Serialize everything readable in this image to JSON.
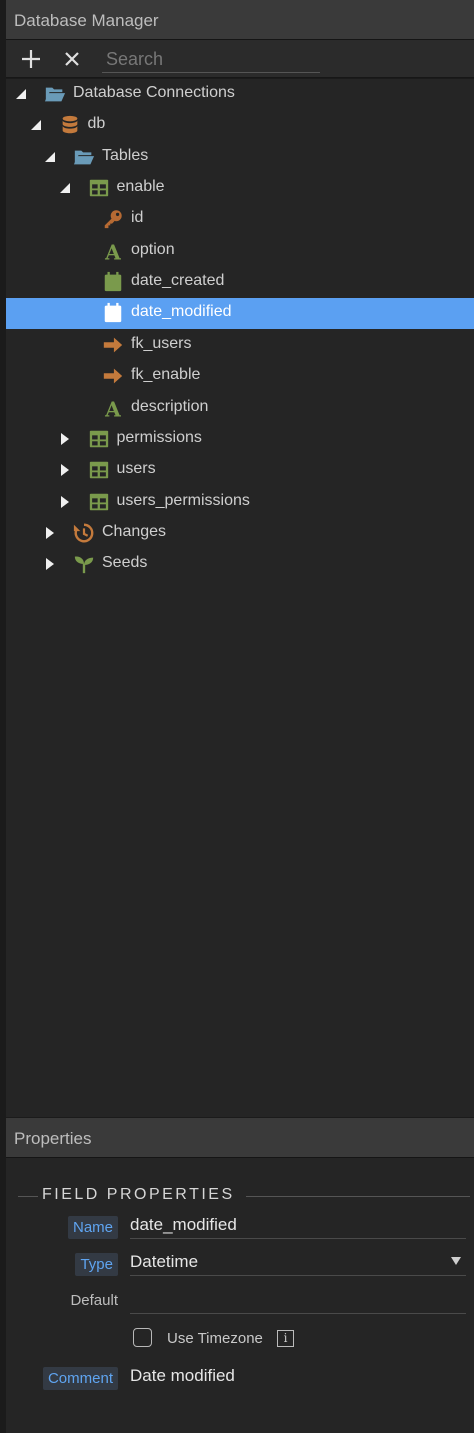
{
  "database_manager": {
    "title": "Database Manager",
    "toolbar": {
      "add_icon": "plus-icon",
      "remove_icon": "close-icon",
      "search_placeholder": "Search"
    },
    "tree": [
      {
        "label": "Database Connections",
        "icon": "folder-open-icon",
        "expanded": true
      },
      {
        "label": "db",
        "icon": "database-icon",
        "expanded": true
      },
      {
        "label": "Tables",
        "icon": "folder-open-icon",
        "expanded": true
      },
      {
        "label": "enable",
        "icon": "table-icon",
        "expanded": true
      },
      {
        "label": "id",
        "icon": "key-icon"
      },
      {
        "label": "option",
        "icon": "text-field-icon"
      },
      {
        "label": "date_created",
        "icon": "calendar-icon"
      },
      {
        "label": "date_modified",
        "icon": "calendar-icon",
        "selected": true
      },
      {
        "label": "fk_users",
        "icon": "arrow-right-icon"
      },
      {
        "label": "fk_enable",
        "icon": "arrow-right-icon"
      },
      {
        "label": "description",
        "icon": "text-field-icon"
      },
      {
        "label": "permissions",
        "icon": "table-icon",
        "expanded": false
      },
      {
        "label": "users",
        "icon": "table-icon",
        "expanded": false
      },
      {
        "label": "users_permissions",
        "icon": "table-icon",
        "expanded": false
      },
      {
        "label": "Changes",
        "icon": "history-icon",
        "expanded": false
      },
      {
        "label": "Seeds",
        "icon": "sprout-icon",
        "expanded": false
      }
    ]
  },
  "properties": {
    "title": "Properties",
    "section_title": "FIELD PROPERTIES",
    "name_label": "Name",
    "name_value": "date_modified",
    "type_label": "Type",
    "type_value": "Datetime",
    "default_label": "Default",
    "default_value": "",
    "use_timezone_label": "Use Timezone",
    "use_timezone_checked": false,
    "info_glyph": "i",
    "comment_label": "Comment",
    "comment_value": "Date modified"
  },
  "colors": {
    "selection": "#5ba0f2",
    "folder": "#6a9bb8",
    "database": "#c47a3c",
    "table": "#7a9a4c",
    "key": "#b66a33",
    "text_field": "#7a9a4c",
    "calendar": "#7a9a4c",
    "arrow": "#c47a3c",
    "history": "#c47a3c",
    "sprout": "#7a9a4c",
    "tag_text": "#5fa4f0"
  }
}
